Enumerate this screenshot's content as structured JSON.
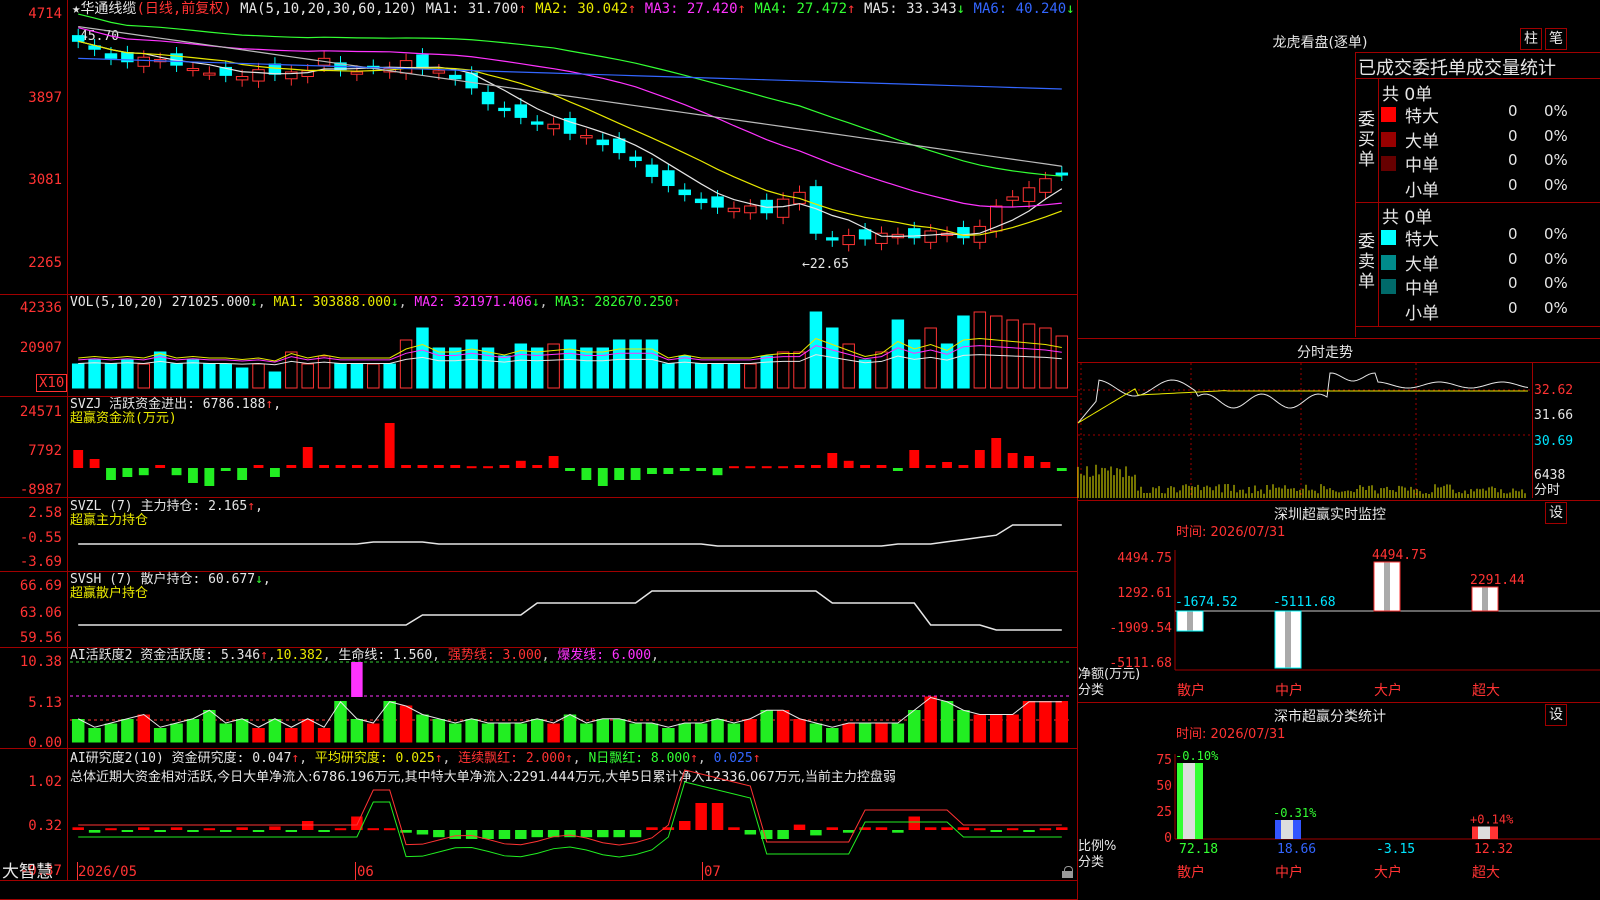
{
  "chart_title": {
    "star": "★",
    "name": "华通线缆",
    "mode": "(日线,前复权)",
    "ma_params": "MA(5,10,20,30,60,120)",
    "ma": [
      {
        "label": "MA1:",
        "value": "31.700",
        "dir": "↑",
        "color": "#e6e6e6"
      },
      {
        "label": "MA2:",
        "value": "30.042",
        "dir": "↑",
        "color": "#e8e800"
      },
      {
        "label": "MA3:",
        "value": "27.420",
        "dir": "↑",
        "color": "#ff33ff"
      },
      {
        "label": "MA4:",
        "value": "27.472",
        "dir": "↑",
        "color": "#33ff33"
      },
      {
        "label": "MA5:",
        "value": "33.343",
        "dir": "↓",
        "color": "#e6e6e6"
      },
      {
        "label": "MA6:",
        "value": "40.240",
        "dir": "↓",
        "color": "#3366ff"
      }
    ]
  },
  "price_axis": [
    "4714",
    "3897",
    "3081",
    "2265"
  ],
  "price_marks": {
    "high": "45.70",
    "low": "←22.65"
  },
  "vol": {
    "title": "VOL(5,10,20)",
    "value": "271025.000",
    "ma1": "MA1: 303888.000",
    "ma2": "MA2: 321971.406",
    "ma3": "MA3: 282670.250",
    "axis": [
      "42336",
      "20907"
    ],
    "unit": "X10"
  },
  "svzj": {
    "title": "SVZJ  活跃资金进出: 6786.188",
    "sub": "超赢资金流(万元)",
    "axis": [
      "24571",
      "7792",
      "-8987"
    ]
  },
  "svzl": {
    "title": "SVZL (7) 主力持仓: 2.165",
    "sub": "超赢主力持仓",
    "axis": [
      "2.58",
      "-0.55",
      "-3.69"
    ]
  },
  "svsh": {
    "title": "SVSH (7) 散户持仓: 60.677",
    "sub": "超赢散户持仓",
    "axis": [
      "66.69",
      "63.06",
      "59.56"
    ]
  },
  "ai1": {
    "title": "AI活跃度2 资金活跃度: 5.346",
    "v2": "10.382",
    "v3": "生命线: 1.560",
    "v4": "强势线: 3.000",
    "v5": "爆发线: 6.000",
    "axis": [
      "10.38",
      "5.13",
      "0.00"
    ]
  },
  "ai2": {
    "title": "AI研究度2(10) 资金研究度: 0.047",
    "v2": "平均研究度: 0.025",
    "v3": "连续飘红: 2.000",
    "v4": "N日飘红: 8.000",
    "v5": "0.025",
    "axis": [
      "1.02",
      "0.32",
      "-0.37"
    ],
    "summary": "总体近期大资金相对活跃,今日大单净流入:6786.196万元,其中特大单净流入:2291.444万元,大单5日累计净入12336.067万元,当前主力控盘弱"
  },
  "date_axis": [
    "2026/05",
    "06",
    "07"
  ],
  "brand": "大智慧",
  "longhu": {
    "title": "龙虎看盘(逐单)",
    "btn1": "柱",
    "btn2": "笔",
    "header": "已成交委托单成交量统计",
    "buy": {
      "label": "委买单",
      "count": "共 0单",
      "rows": [
        {
          "name": "特大",
          "v": "0",
          "p": "0%",
          "color": "#ff0000"
        },
        {
          "name": "大单",
          "v": "0",
          "p": "0%",
          "color": "#990000"
        },
        {
          "name": "中单",
          "v": "0",
          "p": "0%",
          "color": "#660000"
        },
        {
          "name": "小单",
          "v": "0",
          "p": "0%",
          "color": ""
        }
      ]
    },
    "sell": {
      "label": "委卖单",
      "count": "共 0单",
      "rows": [
        {
          "name": "特大",
          "v": "0",
          "p": "0%",
          "color": "#00ffff"
        },
        {
          "name": "大单",
          "v": "0",
          "p": "0%",
          "color": "#008b8b"
        },
        {
          "name": "中单",
          "v": "0",
          "p": "0%",
          "color": "#006a6a"
        },
        {
          "name": "小单",
          "v": "0",
          "p": "0%",
          "color": ""
        }
      ]
    }
  },
  "fenshi": {
    "title": "分时走势",
    "axis": [
      "32.62",
      "31.66",
      "30.69"
    ],
    "vol": "6438",
    "unit": "分时"
  },
  "sz_monitor": {
    "title": "深圳超赢实时监控",
    "btn": "设",
    "time": "时间: 2026/07/31",
    "axis": [
      "4494.75",
      "1292.61",
      "-1909.54",
      "-5111.68"
    ],
    "ylabel": "净额(万元)",
    "xlabel": "分类",
    "bars": [
      {
        "cat": "散户",
        "value": "-1674.52",
        "color": "#ff3333"
      },
      {
        "cat": "中户",
        "value": "-5111.68",
        "color": "#ff3333"
      },
      {
        "cat": "大户",
        "value": "4494.75",
        "color": "#ff3333"
      },
      {
        "cat": "超大",
        "value": "2291.44",
        "color": "#ff3333"
      }
    ]
  },
  "sz_class": {
    "title": "深市超赢分类统计",
    "btn": "设",
    "time": "时间: 2026/07/31",
    "axis": [
      "75",
      "50",
      "25",
      "0"
    ],
    "ylabel": "比例%",
    "xlabel": "分类",
    "bars": [
      {
        "cat": "散户",
        "top": "-0.10%",
        "value": "72.18"
      },
      {
        "cat": "中户",
        "top": "-0.31%",
        "value": "18.66"
      },
      {
        "cat": "大户",
        "top": "",
        "value": "-3.15"
      },
      {
        "cat": "超大",
        "top": "+0.14%",
        "value": "12.32"
      }
    ]
  }
}
